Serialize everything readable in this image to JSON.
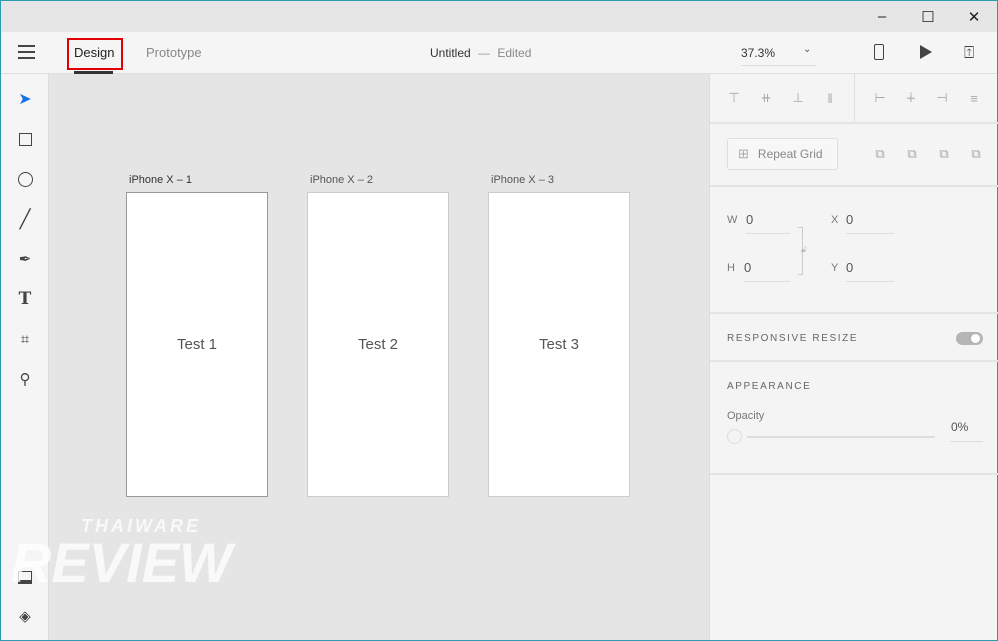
{
  "window": {
    "minimize": "–",
    "maximize": "☐",
    "close": "✕"
  },
  "toolbar": {
    "tabs": [
      {
        "label": "Design",
        "active": true
      },
      {
        "label": "Prototype",
        "active": false
      }
    ],
    "doc_title": "Untitled",
    "separator": "—",
    "doc_status": "Edited",
    "zoom": "37.3%"
  },
  "artboards": [
    {
      "name": "iPhone X – 1",
      "content": "Test 1"
    },
    {
      "name": "iPhone X – 2",
      "content": "Test 2"
    },
    {
      "name": "iPhone X – 3",
      "content": "Test 3"
    }
  ],
  "panel": {
    "repeat_grid": "Repeat Grid",
    "w_label": "W",
    "w": "0",
    "h_label": "H",
    "h": "0",
    "x_label": "X",
    "x": "0",
    "y_label": "Y",
    "y": "0",
    "responsive_resize": "RESPONSIVE RESIZE",
    "responsive_on": true,
    "appearance": "APPEARANCE",
    "opacity_label": "Opacity",
    "opacity": "0%"
  },
  "watermark": {
    "line1": "THAIWARE",
    "line2": "REVIEW"
  },
  "colors": {
    "accent": "#1473e6",
    "highlight_box": "#e00000"
  }
}
